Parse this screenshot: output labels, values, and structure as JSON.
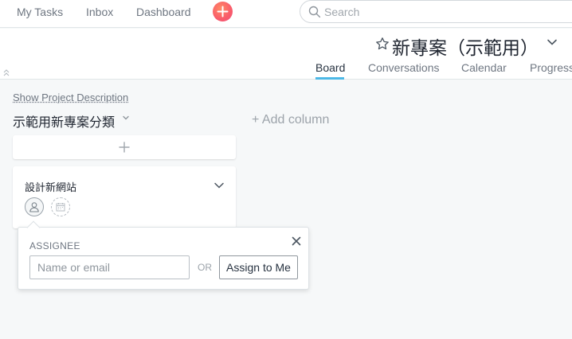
{
  "topnav": {
    "my_tasks": "My Tasks",
    "inbox": "Inbox",
    "dashboard": "Dashboard",
    "add_icon": "plus-icon",
    "search_placeholder": "Search"
  },
  "project": {
    "title": "新專案（示範用）",
    "tabs": [
      {
        "label": "Board",
        "active": true
      },
      {
        "label": "Conversations",
        "active": false
      },
      {
        "label": "Calendar",
        "active": false
      },
      {
        "label": "Progress",
        "active": false
      }
    ]
  },
  "board": {
    "show_description": "Show Project Description",
    "column_title": "示範用新專案分類",
    "add_column": "+ Add column",
    "cards": [
      {
        "title": "設計新網站"
      }
    ]
  },
  "assignee_popover": {
    "label": "ASSIGNEE",
    "input_placeholder": "Name or email",
    "or_text": "OR",
    "assign_to_me": "Assign to Me"
  },
  "colors": {
    "accent_tab": "#4cb8e6",
    "add_button": "#f95b6a",
    "background": "#f6f8f9"
  }
}
